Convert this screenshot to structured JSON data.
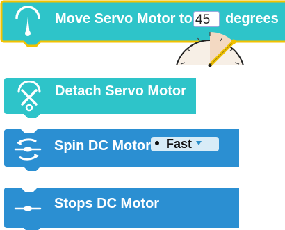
{
  "colors": {
    "servo_block": "#2ec4c9",
    "dc_block": "#2b8fd2",
    "selection_outline": "#f2c200",
    "dropdown_bg": "#d8ecf7",
    "gauge_pointer": "#f2c200"
  },
  "blocks": [
    {
      "id": "move-servo",
      "icon": "servo-angle-icon",
      "label": "Move Servo Motor to",
      "input_value": "45",
      "suffix": "degrees",
      "selected": true,
      "gauge_value_degrees": 45
    },
    {
      "id": "detach-servo",
      "icon": "servo-detach-icon",
      "label": "Detach Servo Motor"
    },
    {
      "id": "spin-dc",
      "icon": "dc-spin-icon",
      "label": "Spin DC Motor",
      "dropdown_value": "Fast"
    },
    {
      "id": "stop-dc",
      "icon": "dc-stop-icon",
      "label": "Stops DC Motor"
    }
  ]
}
